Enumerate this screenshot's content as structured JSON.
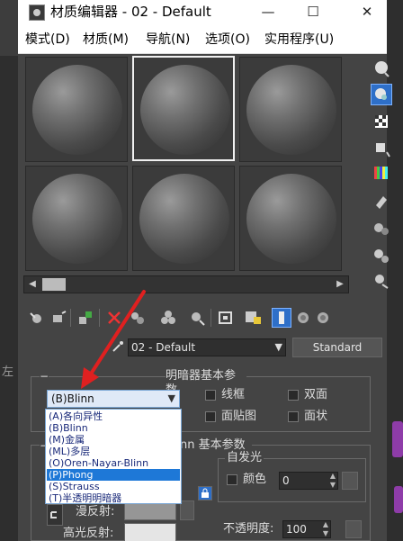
{
  "window": {
    "title": "材质编辑器 - 02 - Default",
    "minimize": "—",
    "maximize": "☐",
    "close": "✕"
  },
  "menu": [
    "模式(D)",
    "材质(M)",
    "导航(N)",
    "选项(O)",
    "实用程序(U)"
  ],
  "material": {
    "name": "02 - Default",
    "type_button": "Standard"
  },
  "shader_basic": {
    "title": "明暗器基本参数",
    "collapse": "−",
    "selected_shader": "(B)Blinn",
    "checkboxes": [
      "线框",
      "双面",
      "面贴图",
      "面状"
    ]
  },
  "shader_dropdown": {
    "options": [
      "(A)各向异性",
      "(B)Blinn",
      "(M)金属",
      "(ML)多层",
      "(O)Oren-Nayar-Blinn",
      "(P)Phong",
      "(S)Strauss",
      "(T)半透明明暗器"
    ],
    "highlighted_index": 5
  },
  "blinn_basic": {
    "title": "Blinn 基本参数",
    "title_visible": "nn 基本参数",
    "collapse": "−",
    "self_illum_group": "自发光",
    "color_label": "颜色",
    "color_value": "0",
    "diffuse_label": "漫反射:",
    "specular_label": "高光反射:",
    "opacity_label": "不透明度:",
    "opacity_value": "100"
  },
  "left_edge_text": "左",
  "colors": {
    "window_bg": "#444444",
    "selected_blue": "#1e78d7",
    "arrow_red": "#e02020"
  }
}
